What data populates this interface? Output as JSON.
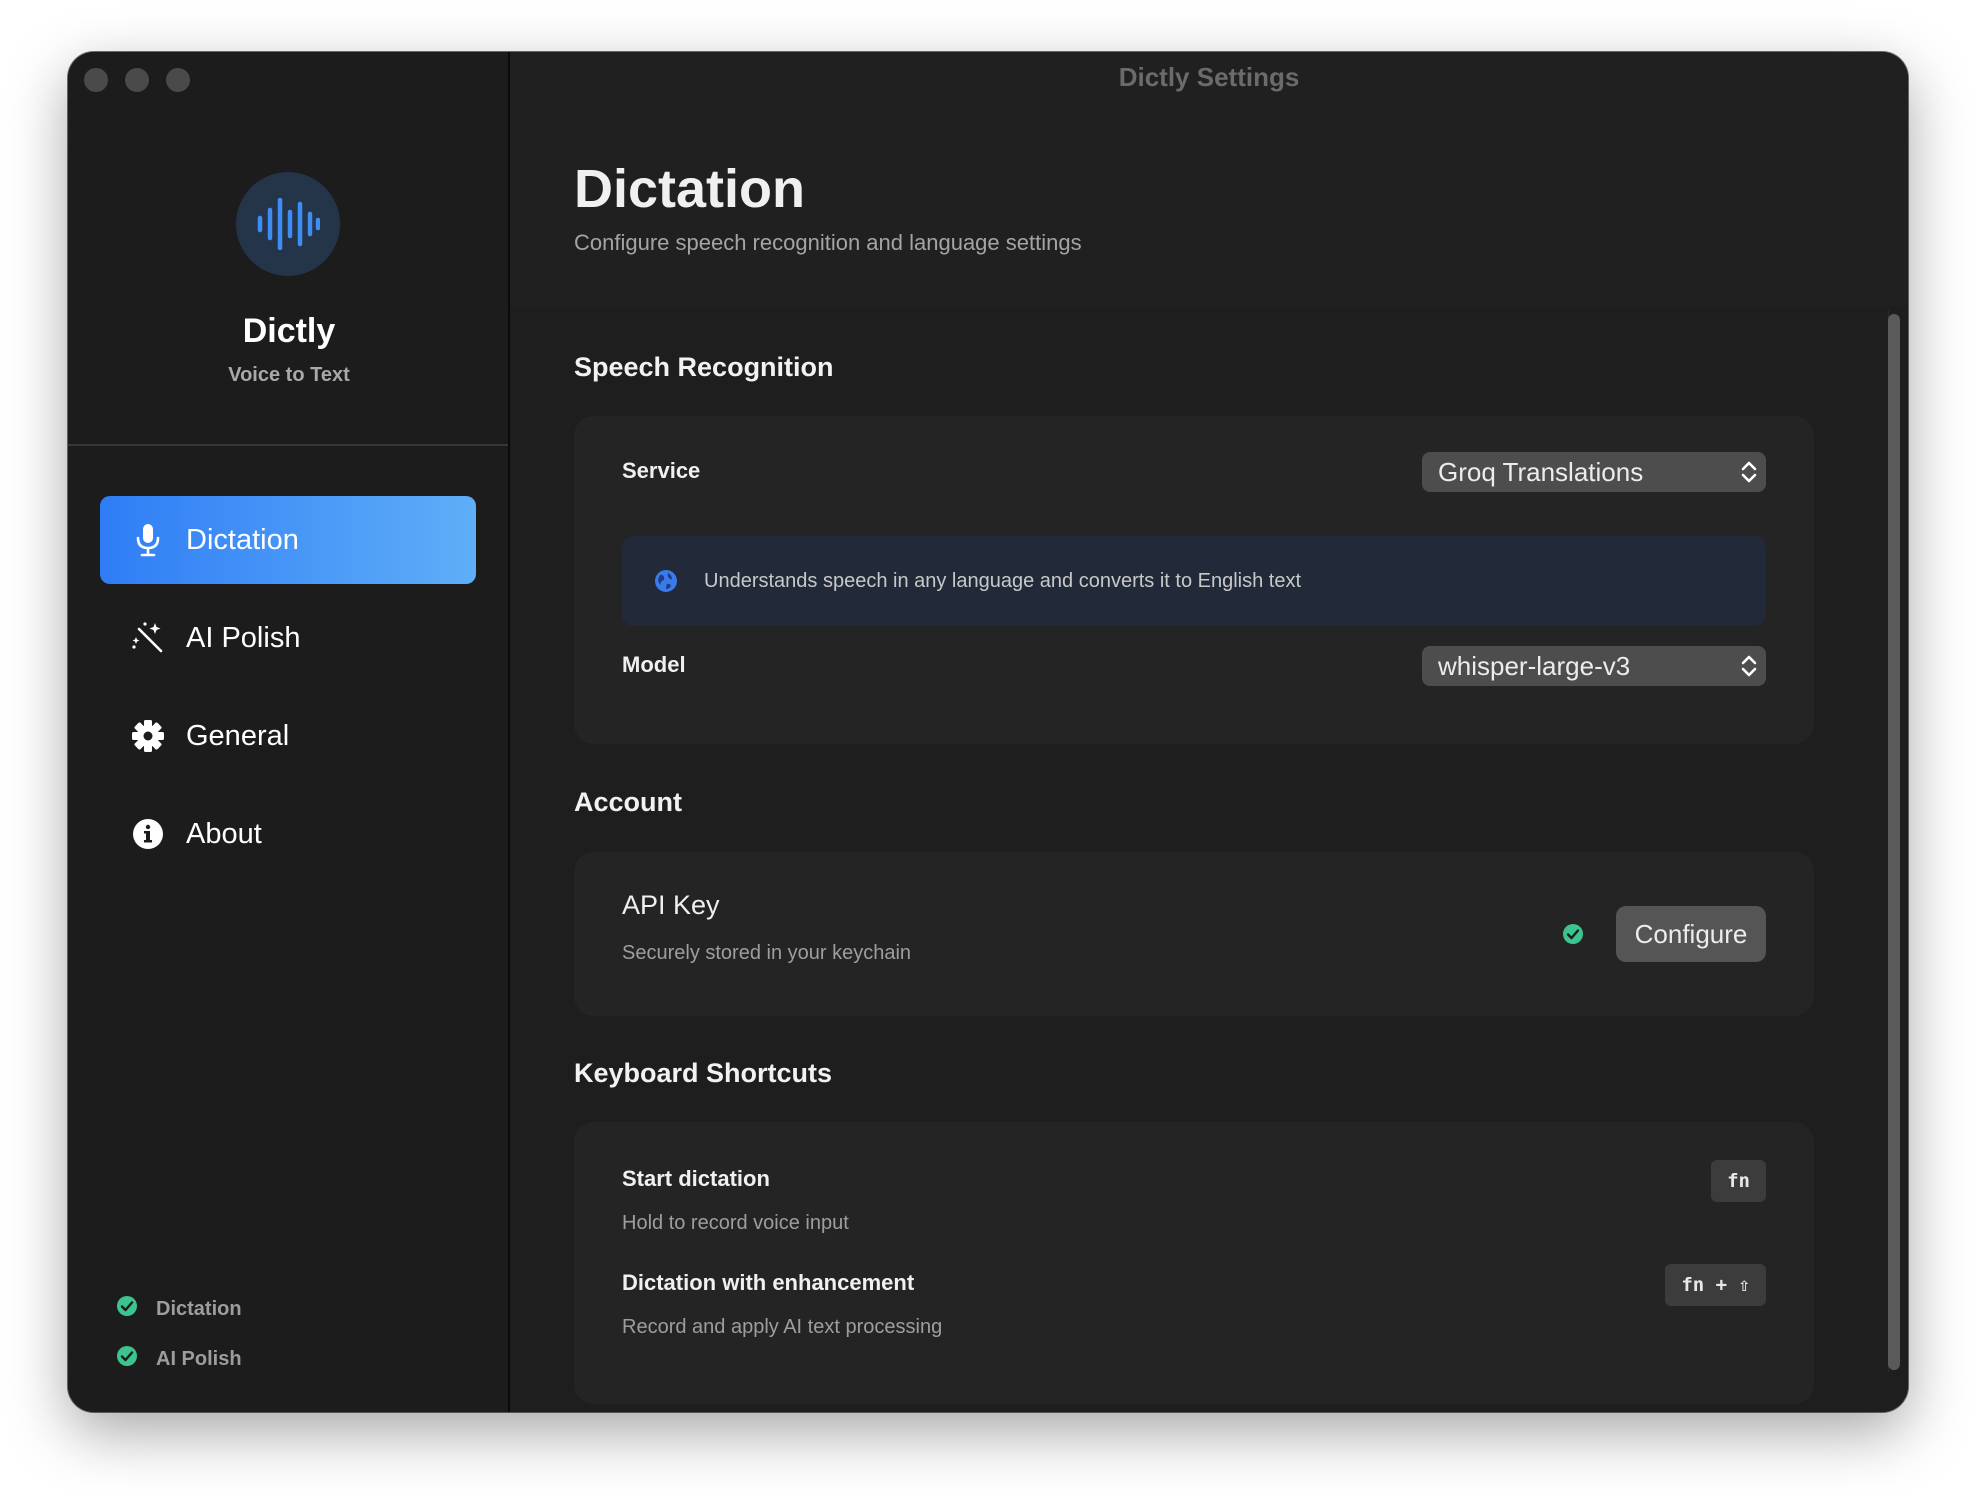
{
  "window": {
    "title": "Dictly Settings"
  },
  "sidebar": {
    "app_name": "Dictly",
    "app_tagline": "Voice to Text",
    "items": [
      {
        "label": "Dictation",
        "icon": "microphone-icon",
        "active": true
      },
      {
        "label": "AI Polish",
        "icon": "magic-wand-icon",
        "active": false
      },
      {
        "label": "General",
        "icon": "gear-icon",
        "active": false
      },
      {
        "label": "About",
        "icon": "info-icon",
        "active": false
      }
    ],
    "status": [
      {
        "label": "Dictation",
        "icon": "check-circle-icon"
      },
      {
        "label": "AI Polish",
        "icon": "check-circle-icon"
      }
    ]
  },
  "header": {
    "title": "Dictation",
    "subtitle": "Configure speech recognition and language settings"
  },
  "speech_recognition": {
    "title": "Speech Recognition",
    "service_label": "Service",
    "service_value": "Groq Translations",
    "info_text": "Understands speech in any language and converts it to English text",
    "model_label": "Model",
    "model_value": "whisper-large-v3"
  },
  "account": {
    "title": "Account",
    "api_key_label": "API Key",
    "api_key_desc": "Securely stored in your keychain",
    "configure_label": "Configure"
  },
  "shortcuts": {
    "title": "Keyboard Shortcuts",
    "items": [
      {
        "label": "Start dictation",
        "desc": "Hold to record voice input",
        "keys": "fn"
      },
      {
        "label": "Dictation with enhancement",
        "desc": "Record and apply AI text processing",
        "keys": "fn + ⇧"
      }
    ]
  },
  "colors": {
    "accent": "#2f7df6",
    "accent_light": "#5eaef8",
    "success": "#3cc48f",
    "window_bg": "#1e1e1e"
  }
}
